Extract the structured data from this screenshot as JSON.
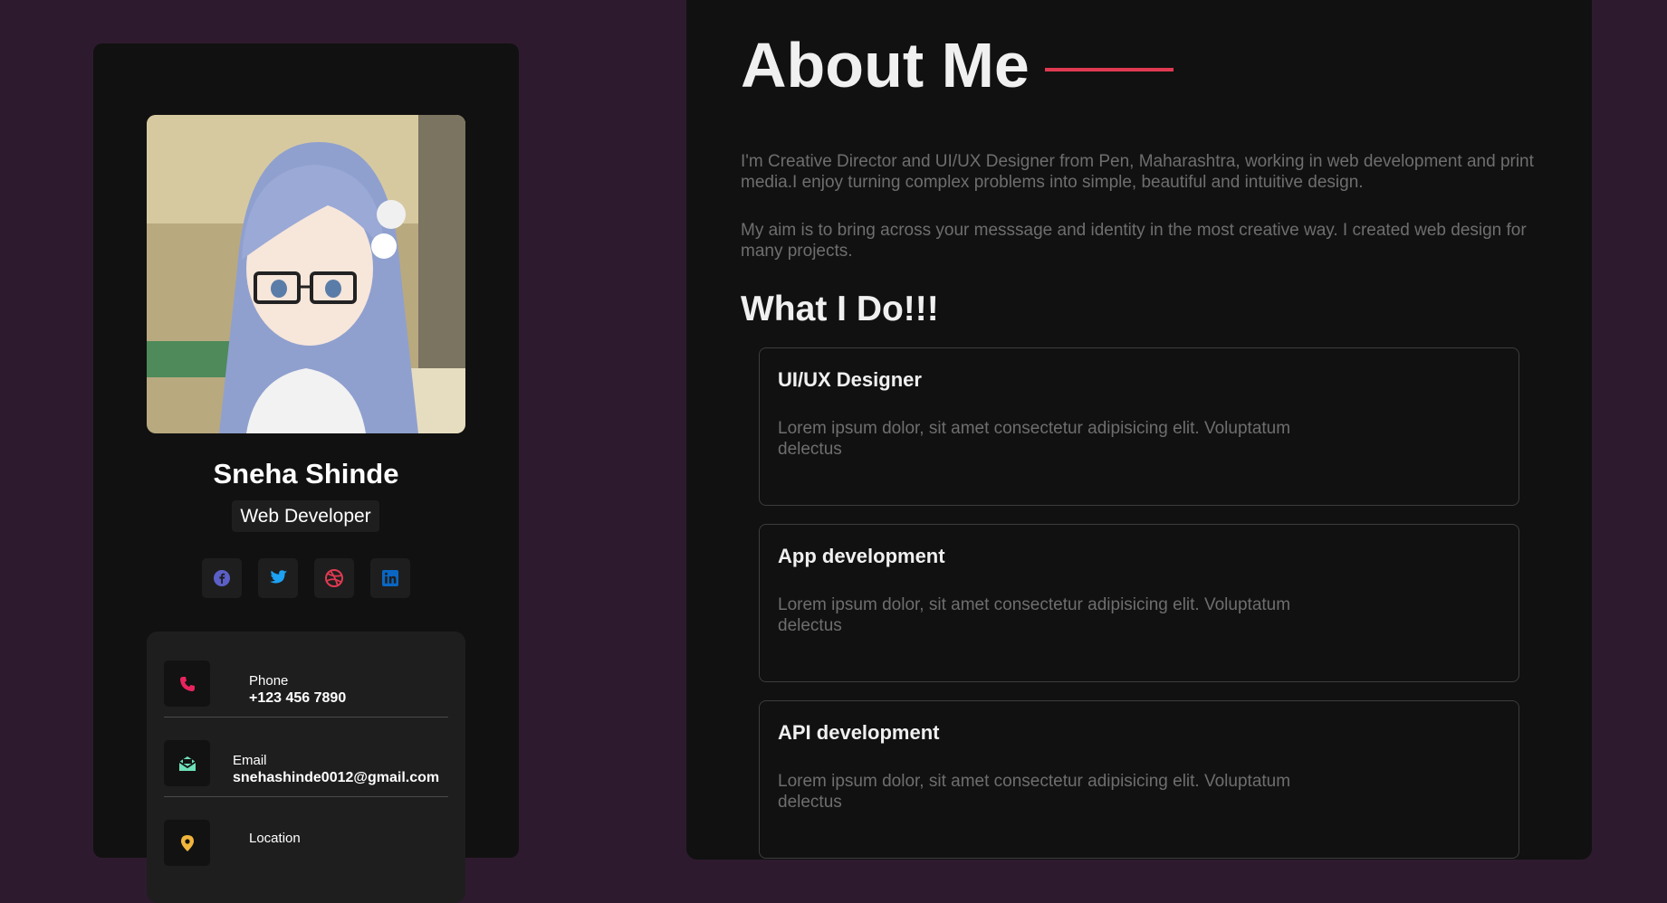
{
  "profile": {
    "name": "Sneha Shinde",
    "role": "Web Developer"
  },
  "socials": [
    {
      "icon": "facebook-icon",
      "color": "#5b5fc7"
    },
    {
      "icon": "twitter-icon",
      "color": "#1da1f2"
    },
    {
      "icon": "dribbble-icon",
      "color": "#e03a52"
    },
    {
      "icon": "linkedin-icon",
      "color": "#0a66c2"
    }
  ],
  "contacts": {
    "phone": {
      "label": "Phone",
      "value": "+123 456 7890",
      "icon": "phone-icon",
      "color": "#e8245f"
    },
    "email": {
      "label": "Email",
      "value": "snehashinde0012@gmail.com",
      "icon": "envelope-open-icon",
      "color": "#6ee0b8"
    },
    "location": {
      "label": "Location",
      "icon": "location-icon"
    }
  },
  "about": {
    "title": "About Me",
    "accent_color": "#e03a52",
    "paragraphs": [
      "I'm Creative Director and UI/UX Designer from Pen, Maharashtra, working in web development and print media.I enjoy turning complex problems into simple, beautiful and intuitive design.",
      "My aim is to bring across your messsage and identity in the most creative way. I created web design for many projects."
    ]
  },
  "services": {
    "title": "What I Do!!!",
    "items": [
      {
        "title": "UI/UX Designer",
        "description": "Lorem ipsum dolor, sit amet consectetur adipisicing elit. Voluptatum delectus"
      },
      {
        "title": "App development",
        "description": "Lorem ipsum dolor, sit amet consectetur adipisicing elit. Voluptatum delectus"
      },
      {
        "title": "API development",
        "description": "Lorem ipsum dolor, sit amet consectetur adipisicing elit. Voluptatum delectus"
      }
    ]
  }
}
